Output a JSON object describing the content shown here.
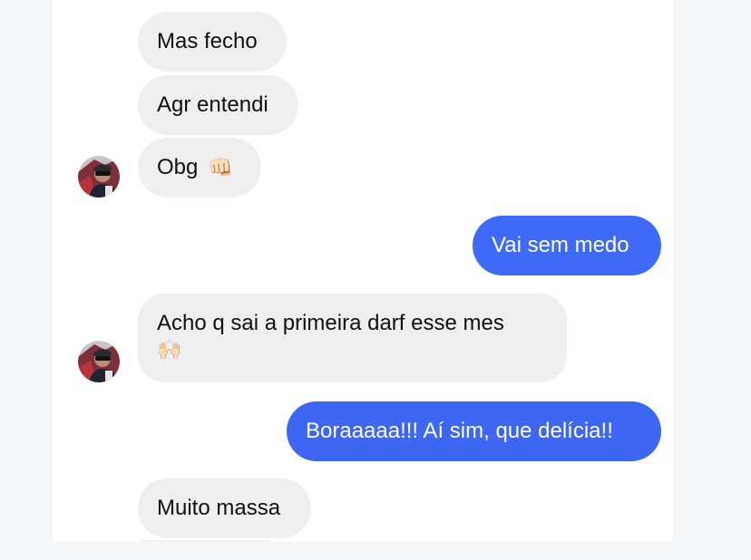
{
  "messages": [
    {
      "id": "m1",
      "direction": "incoming",
      "text": "Mas fecho"
    },
    {
      "id": "m2",
      "direction": "incoming",
      "text": "Agr entendi"
    },
    {
      "id": "m3",
      "direction": "incoming",
      "text": "Obg",
      "emoji": "👊🏻"
    },
    {
      "id": "m4",
      "direction": "outgoing",
      "text": "Vai sem medo"
    },
    {
      "id": "m5",
      "direction": "incoming",
      "text": "Acho q sai a primeira darf esse mes",
      "emoji": "🙌🏻"
    },
    {
      "id": "m6",
      "direction": "outgoing",
      "text": "Boraaaaa!!! Aí sim, que delícia!!"
    },
    {
      "id": "m7",
      "direction": "incoming",
      "text": "Muito massa"
    }
  ],
  "colors": {
    "incoming_bubble": "#efefef",
    "outgoing_bubble": "#3f6af8",
    "page_background": "#f5f6f8"
  },
  "icons": {
    "avatar": "contact-avatar",
    "fist": "oncoming-fist-emoji",
    "raised_hands": "raised-hands-emoji"
  }
}
